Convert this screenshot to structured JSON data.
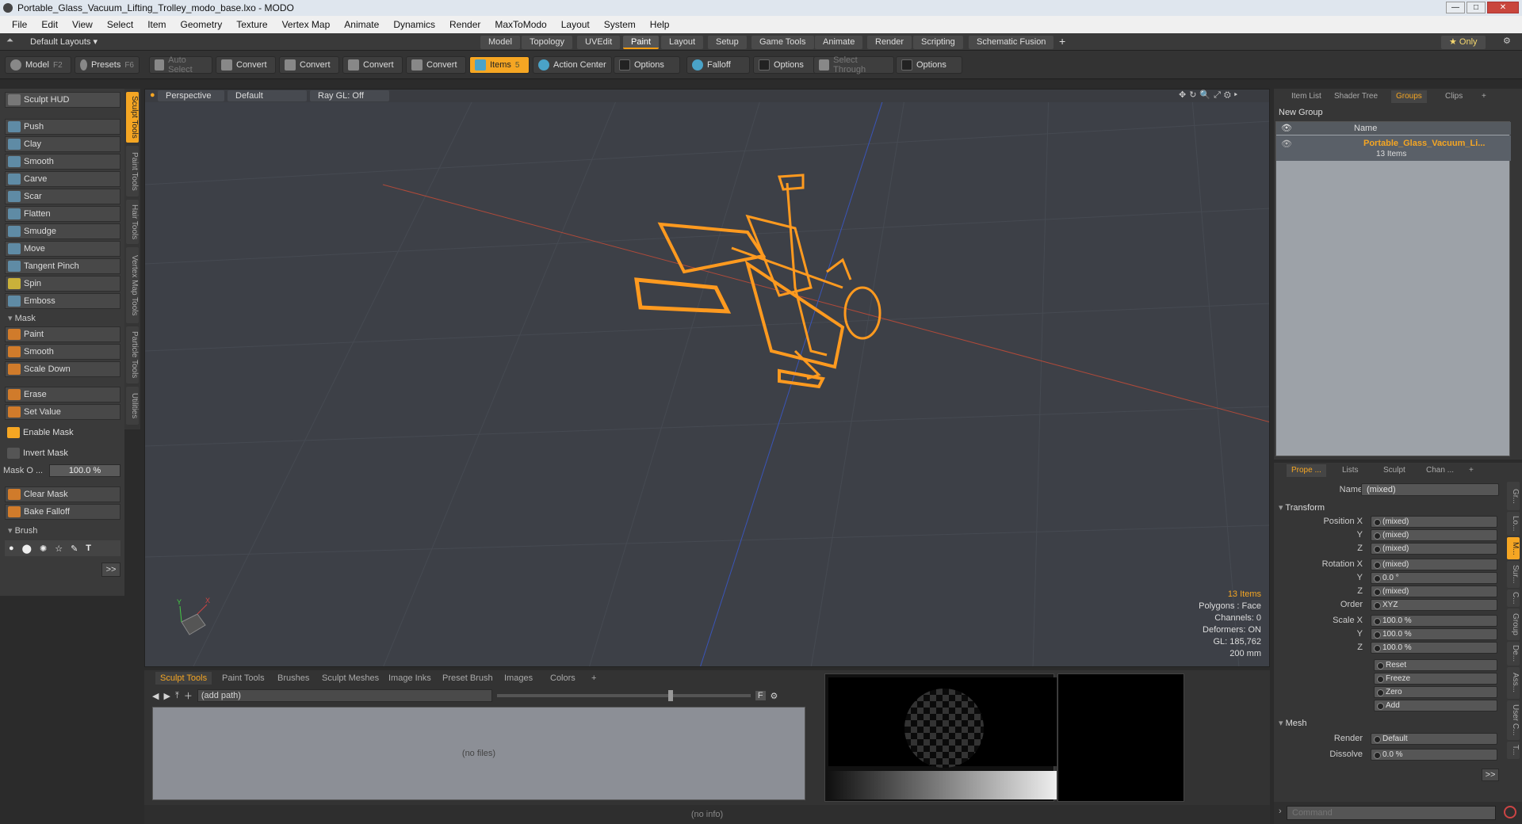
{
  "window": {
    "title": "Portable_Glass_Vacuum_Lifting_Trolley_modo_base.lxo - MODO",
    "min": "—",
    "max": "□",
    "close": "✕"
  },
  "menu": [
    "File",
    "Edit",
    "View",
    "Select",
    "Item",
    "Geometry",
    "Texture",
    "Vertex Map",
    "Animate",
    "Dynamics",
    "Render",
    "MaxToModo",
    "Layout",
    "System",
    "Help"
  ],
  "layout": {
    "name": "Default Layouts ▾",
    "tabs": [
      "Model",
      "Topology",
      "UVEdit",
      "Paint",
      "Layout",
      "Setup",
      "Game Tools",
      "Animate",
      "Render",
      "Scripting",
      "Schematic Fusion"
    ],
    "add": "+",
    "only": "★ Only"
  },
  "toolbar": {
    "model": "Model",
    "model_key": "F2",
    "presets": "Presets",
    "presets_key": "F6",
    "auto_select": "Auto Select",
    "convert": "Convert",
    "items": "Items",
    "items_key": "5",
    "action_center": "Action Center",
    "options": "Options",
    "falloff": "Falloff",
    "select_through": "Select Through"
  },
  "sculpt": {
    "hud": "Sculpt HUD",
    "tools": [
      "Push",
      "Clay",
      "Smooth",
      "Carve",
      "Scar",
      "Flatten",
      "Smudge",
      "Move",
      "Tangent Pinch",
      "Spin",
      "Emboss"
    ],
    "mask_label": "Mask",
    "mask_tools": [
      "Paint",
      "Smooth",
      "Scale Down"
    ],
    "erase": "Erase",
    "set_value": "Set Value",
    "enable_mask": "Enable Mask",
    "invert_mask": "Invert Mask",
    "mask_opacity_label": "Mask O ...",
    "mask_opacity": "100.0 %",
    "clear_mask": "Clear Mask",
    "bake_falloff": "Bake Falloff",
    "brush_label": "Brush",
    "expand": ">>"
  },
  "sidetabs": [
    "Sculpt Tools",
    "Paint Tools",
    "Hair Tools",
    "Vertex Map Tools",
    "Particle Tools",
    "Utilities"
  ],
  "viewport": {
    "view": "Perspective",
    "shading": "Default",
    "raygl": "Ray GL: Off",
    "info": {
      "items": "13 Items",
      "polygons": "Polygons : Face",
      "channels": "Channels: 0",
      "deformers": "Deformers: ON",
      "gl": "GL: 185,762",
      "scale": "200 mm"
    },
    "axis_y": "Y",
    "axis_x": "X"
  },
  "bottom": {
    "tabs": [
      "Sculpt Tools",
      "Paint Tools",
      "Brushes",
      "Sculpt Meshes",
      "Image Inks",
      "Preset Brush",
      "Images",
      "Colors"
    ],
    "add": "+",
    "path": "(add path)",
    "nofiles": "(no files)",
    "f": "F"
  },
  "status": "(no info)",
  "groups": {
    "tabs": [
      "Item List",
      "Shader Tree",
      "Groups",
      "Clips"
    ],
    "add": "+",
    "new_group": "New Group",
    "col_name": "Name",
    "item_name": "Portable_Glass_Vacuum_Li...",
    "item_count": "13 Items"
  },
  "props": {
    "tabs": [
      "Prope ...",
      "Lists",
      "Sculpt",
      "Chan ..."
    ],
    "add": "+",
    "name_label": "Name",
    "name_value": "(mixed)",
    "transform": "Transform",
    "position_x": "Position X",
    "y": "Y",
    "z": "Z",
    "pos": [
      "(mixed)",
      "(mixed)",
      "(mixed)"
    ],
    "rotation_x": "Rotation X",
    "rot": [
      "(mixed)",
      "0.0 °",
      "(mixed)"
    ],
    "order_label": "Order",
    "order": "XYZ",
    "scale_x": "Scale X",
    "scale": [
      "100.0 %",
      "100.0 %",
      "100.0 %"
    ],
    "reset": "Reset",
    "freeze": "Freeze",
    "zero": "Zero",
    "add_btn": "Add",
    "mesh": "Mesh",
    "render_label": "Render",
    "render": "Default",
    "dissolve_label": "Dissolve",
    "dissolve": "0.0 %",
    "expand": ">>",
    "right_tabs": [
      "Gr...",
      "Lo...",
      "M...",
      "Sur...",
      "C...",
      "Group",
      "De...",
      "Ass...",
      "User C...",
      "T..."
    ]
  },
  "command": {
    "placeholder": "Command"
  },
  "colors": {
    "accent": "#f5a623",
    "wire": "#ff9a1f",
    "axis_red": "#b04a3a",
    "axis_blue": "#3a54b8"
  }
}
